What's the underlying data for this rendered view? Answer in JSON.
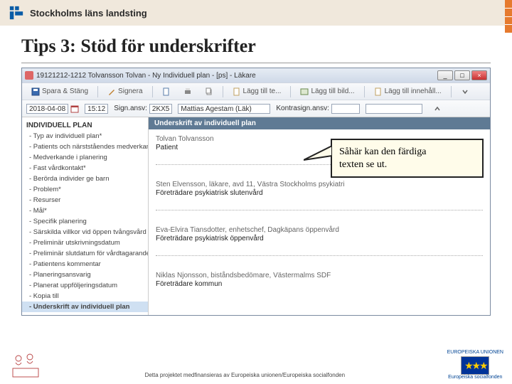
{
  "header": {
    "org": "Stockholms läns landsting"
  },
  "slide": {
    "title": "Tips 3: Stöd för underskrifter"
  },
  "window": {
    "title": "19121212-1212 Tolvansson Tolvan - Ny Individuell plan - [ps] - Läkare",
    "min": "_",
    "max": "□",
    "close": "×"
  },
  "toolbar1": {
    "save": "Spara & Stäng",
    "signera": "Signera",
    "add_text": "Lägg till te...",
    "add_image": "Lägg till bild...",
    "add_content": "Lägg till innehåll..."
  },
  "toolbar2": {
    "date": "2018-04-08",
    "time": "15:12",
    "sign_label": "Sign.ansv:",
    "sign_code": "2KX5",
    "sign_name": "Mattias Agestam (Läk)",
    "kontra_label": "Kontrasign.ansv:"
  },
  "sidebar": {
    "head": "INDIVIDUELL PLAN",
    "items": [
      "- Typ av individuell plan*",
      "- Patients och närstståendes medverkan*",
      "- Medverkande i planering",
      "- Fast vårdkontakt*",
      "- Berörda individer ge barn",
      "- Problem*",
      "- Resurser",
      "- Mål*",
      "- Specifik planering",
      "- Särskilda villkor vid öppen tvångsvård",
      "- Preliminär utskrivningsdatum",
      "- Preliminär slutdatum för vårdtagarande",
      "- Patientens kommentar",
      "- Planeringsansvarig",
      "- Planerat uppföljeringsdatum",
      "- Kopia till"
    ],
    "selected": "- Underskrift av individuell plan"
  },
  "main": {
    "section_title": "Underskrift av individuell plan",
    "b1_name": "Tolvan Tolvansson",
    "b1_role": "Patient",
    "b2_line1": "Sten Elvensson, läkare, avd 11, Västra Stockholms psykiatri",
    "b2_line2": "Företrädare psykiatrisk slutenvård",
    "b3_line1": "Eva-Elvira Tiansdotter, enhetschef, Dagkäpans öppenvård",
    "b3_line2": "Företrädare psykiatrisk öppenvård",
    "b4_line1": "Niklas Njonsson, biståndsbedömare, Västermalms SDF",
    "b4_line2": "Företrädare kommun"
  },
  "callout": {
    "text1": "Såhär kan den färdiga",
    "text2": "texten se ut."
  },
  "footer": {
    "note": "Detta projektet medfinansieras av Europeiska unionen/Europeiska socialfonden",
    "eu_top": "EUROPEISKA UNIONEN",
    "eu_bottom": "Europeiska socialfonden"
  }
}
